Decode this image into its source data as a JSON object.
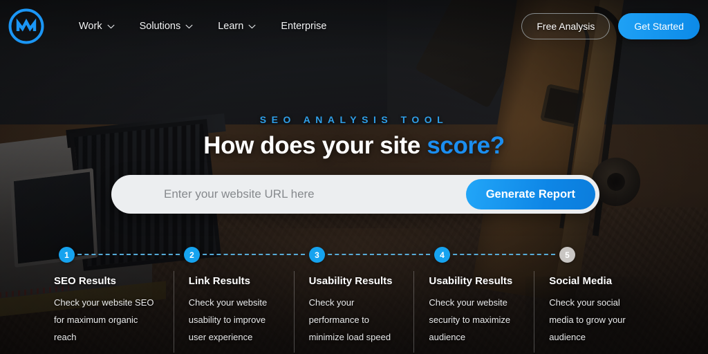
{
  "brand": {
    "logo_icon": "m-monogram-circle-logo",
    "accent_color": "#1b8ef0",
    "logo_color": "#1b96f5"
  },
  "header": {
    "nav": [
      {
        "label": "Work",
        "has_dropdown": true,
        "icon": "chevron-down-icon"
      },
      {
        "label": "Solutions",
        "has_dropdown": true,
        "icon": "chevron-down-icon"
      },
      {
        "label": "Learn",
        "has_dropdown": true,
        "icon": "chevron-down-icon"
      },
      {
        "label": "Enterprise",
        "has_dropdown": false,
        "icon": ""
      }
    ],
    "free_analysis_label": "Free Analysis",
    "get_started_label": "Get Started"
  },
  "hero": {
    "eyebrow": "SEO ANALYSIS TOOL",
    "headline_main": "How does your site ",
    "headline_accent": "score?"
  },
  "search": {
    "placeholder": "Enter your website URL here",
    "value": "",
    "button_label": "Generate Report"
  },
  "steps": {
    "active_color": "#16a3ef",
    "inactive_color": "#c9c6c3",
    "connector_color": "#5fc0f4",
    "items": [
      {
        "number": "1",
        "state": "active",
        "title": "SEO Results",
        "description": "Check your website SEO for maximum organic reach"
      },
      {
        "number": "2",
        "state": "active",
        "title": "Link Results",
        "description": "Check your website usability to improve user experience"
      },
      {
        "number": "3",
        "state": "active",
        "title": "Usability Results",
        "description": "Check your performance to minimize load speed"
      },
      {
        "number": "4",
        "state": "active",
        "title": "Usability Results",
        "description": "Check your website security to maximize audience"
      },
      {
        "number": "5",
        "state": "inactive",
        "title": "Social Media",
        "description": "Check your social media to grow your audience"
      }
    ]
  }
}
